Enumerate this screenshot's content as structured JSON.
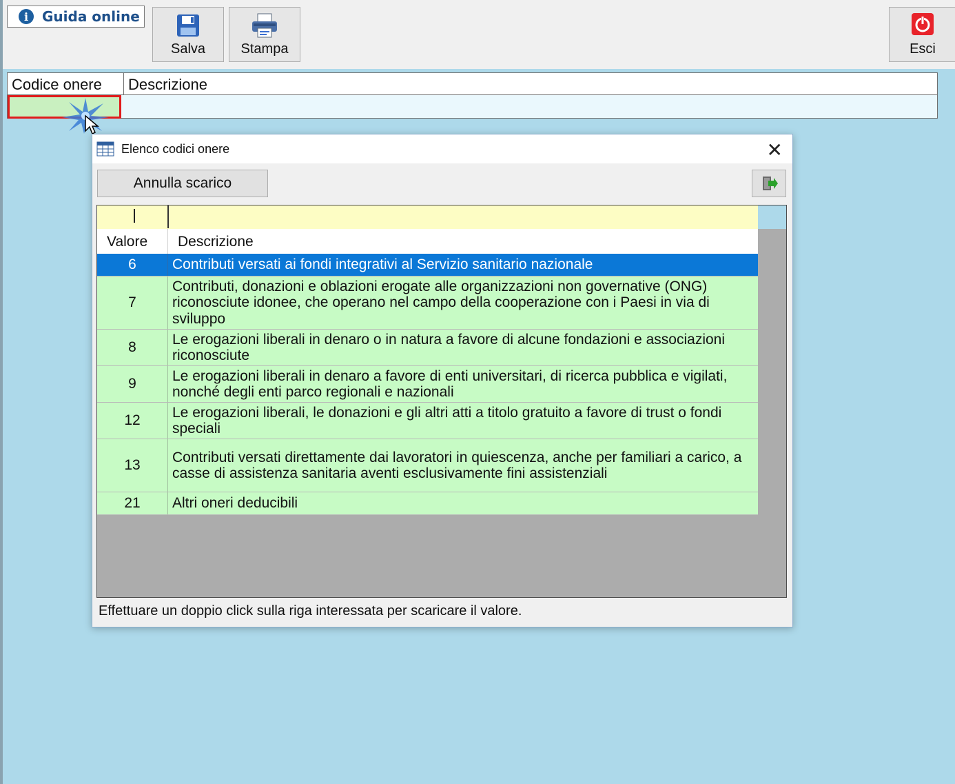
{
  "toolbar": {
    "guida_label": "Guida online",
    "salva_label": "Salva",
    "stampa_label": "Stampa",
    "esci_label": "Esci"
  },
  "grid": {
    "col_codice": "Codice onere",
    "col_descrizione": "Descrizione"
  },
  "dialog": {
    "title": "Elenco codici onere",
    "annulla_label": "Annulla scarico",
    "col_valore": "Valore",
    "col_descrizione": "Descrizione",
    "rows": [
      {
        "valore": "6",
        "descrizione": "Contributi versati ai fondi integrativi al Servizio sanitario nazionale",
        "selected": true
      },
      {
        "valore": "7",
        "descrizione": "Contributi, donazioni e oblazioni erogate alle organizzazioni non governative (ONG) riconosciute idonee, che operano nel campo della cooperazione con i Paesi in via di sviluppo"
      },
      {
        "valore": "8",
        "descrizione": "Le erogazioni liberali in denaro o in natura a favore di alcune fondazioni e associazioni riconosciute"
      },
      {
        "valore": "9",
        "descrizione": "Le erogazioni liberali in denaro a favore di enti universitari, di ricerca pubblica e vigilati, nonché degli enti parco regionali e nazionali"
      },
      {
        "valore": "12",
        "descrizione": "Le erogazioni liberali, le donazioni e gli altri atti a titolo gratuito a favore di trust o fondi speciali"
      },
      {
        "valore": "13",
        "descrizione": "Contributi versati direttamente dai lavoratori in quiescenza, anche per familiari a carico, a casse di assistenza sanitaria aventi esclusivamente fini assistenziali"
      },
      {
        "valore": "21",
        "descrizione": "Altri oneri deducibili"
      }
    ],
    "hint": "Effettuare un doppio click sulla riga interessata per scaricare il valore."
  }
}
